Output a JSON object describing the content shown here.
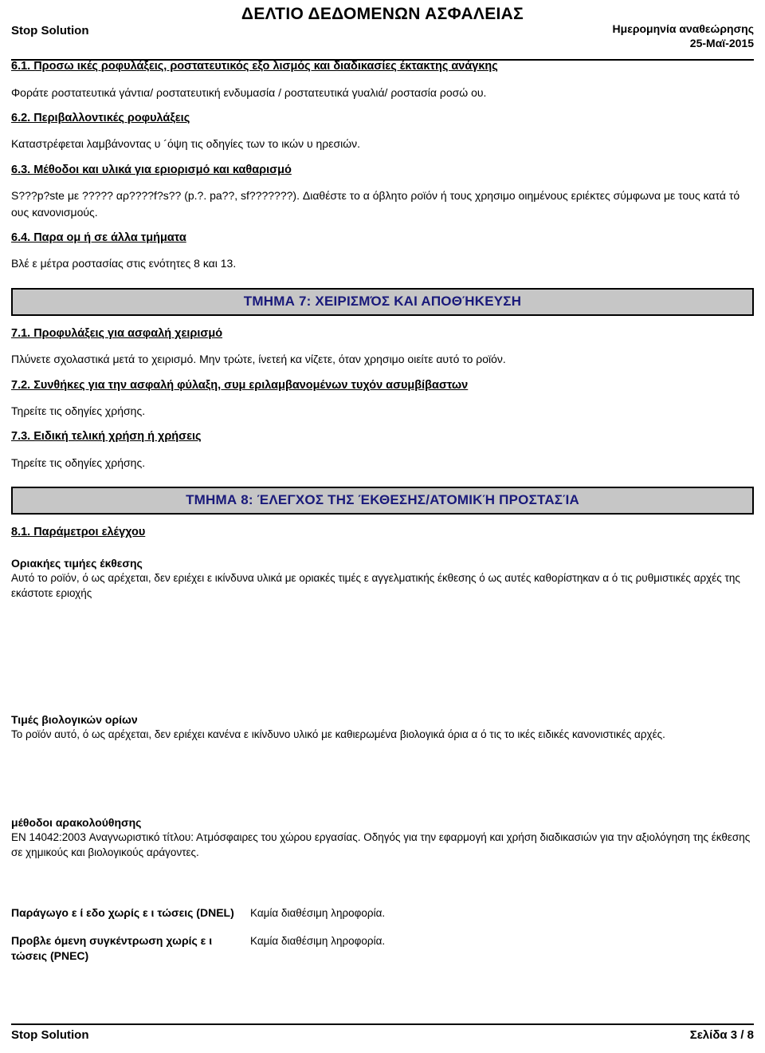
{
  "header": {
    "title": "ΔΕΛΤΙΟ ΔΕΔΟΜΕΝΩΝ ΑΣΦΑΛΕΙΑΣ",
    "product_name": "Stop Solution",
    "revision_label": "Ημερομηνία αναθεώρησης",
    "revision_date": "25-Μαϊ-2015"
  },
  "sections": {
    "s61": {
      "heading": "6.1. Προσω ικές  ροφυλάξεις,  ροστατευτικός εξο λισμός και διαδικασίες έκτακτης ανάγκης",
      "body": "Φοράτε  ροστατευτικά γάντια/  ροστατευτική ενδυμασία /  ροστατευτικά γυαλιά/  ροστασία  ροσώ ου."
    },
    "s62": {
      "heading": "6.2. Περιβαλλοντικές  ροφυλάξεις",
      "body": "Καταστρέφεται λαμβάνοντας υ ´όψη τις οδηγίες των το ικών υ ηρεσιών."
    },
    "s63": {
      "heading": "6.3. Μέθοδοι και υλικά για  εριορισμό και καθαρισμό",
      "body": "S???p?ste με ????? αρ????f?s?? (p.?. pa??, sf???????). Διαθέστε το α όβλητο  ροϊόν ή τους χρησιμο οιημένους  εριέκτες σύμφωνα με τους κατά τό ους κανονισμούς."
    },
    "s64": {
      "heading": "6.4. Παρα ομ ή σε άλλα τμήματα",
      "body": "Βλέ ε μέτρα  ροστασίας στις ενότητες 8 και 13."
    },
    "banner7": "ΤΜΗΜΑ 7: ΧΕΙΡΙΣΜΌΣ ΚΑΙ ΑΠΟΘΉΚΕΥΣΗ",
    "s71": {
      "heading": "7.1. Προφυλάξεις για ασφαλή χειρισμό",
      "body": "Πλύνετε σχολαστικά μετά το χειρισμό. Μην τρώτε,  ίνετεή κα νίζετε, όταν χρησιμο οιείτε αυτό το  ροϊόν."
    },
    "s72": {
      "heading": "7.2. Συνθήκες για την ασφαλή φύλαξη, συμ εριλαμβανομένων τυχόν ασυμβίβαστων",
      "body": "Τηρείτε τις οδηγίες χρήσης."
    },
    "s73": {
      "heading": "7.3. Ειδική τελική χρήση ή χρήσεις",
      "body": "Τηρείτε τις οδηγίες χρήσης."
    },
    "banner8": "ΤΜΗΜΑ 8: ΈΛΕΓΧΟΣ ΤΗΣ ΈΚΘΕΣΗΣ/ΑΤΟΜΙΚΉ ΠΡΟΣΤΑΣΊΑ",
    "s81": {
      "heading": "8.1. Παράμετροι ελέγχου"
    },
    "exposure_limits": {
      "title": "Οριακήες τιμήες έκθεσης",
      "body": "Αυτό το  ροϊόν, ό ως  αρέχεται, δεν  εριέχει ε ικίνδυνα υλικά με οριακές τιμές ε αγγελματικής έκθεσης ό ως αυτές καθορίστηκαν α ό τις ρυθμιστικές αρχές της εκάστοτε  εριοχής"
    },
    "biological_limits": {
      "title": "Τιμές βιολογικών ορίων",
      "body": "Το  ροϊόν αυτό, ό ως  αρέχεται, δεν  εριέχει κανένα ε ικίνδυνο υλικό με καθιερωμένα βιολογικά όρια α ό τις το ικές ειδικές κανονιστικές αρχές."
    },
    "monitoring": {
      "title": "μέθοδοι  αρακολούθησης",
      "body": "EN 14042:2003 Αναγνωριστικό τίτλου: Ατμόσφαιρες του χώρου εργασίας. Οδηγός για την εφαρμογή και χρήση διαδικασιών για την αξιολόγηση της έκθεσης σε χημικούς και βιολογικούς  αράγοντες."
    },
    "dnel": {
      "key": "Παράγωγο ε ί εδο χωρίς ε ι τώσεις (DNEL)",
      "value": "Καμία διαθέσιμη  ληροφορία."
    },
    "pnec": {
      "key": "Προβλε όμενη συγκέντρωση χωρίς ε ι τώσεις (PNEC)",
      "value": "Καμία διαθέσιμη  ληροφορία."
    }
  },
  "footer": {
    "product_name": "Stop Solution",
    "page_label": "Σελίδα  3 / 8"
  },
  "colors": {
    "banner_bg": "#c6c6c6",
    "banner_text": "#19197a",
    "text": "#000000"
  }
}
